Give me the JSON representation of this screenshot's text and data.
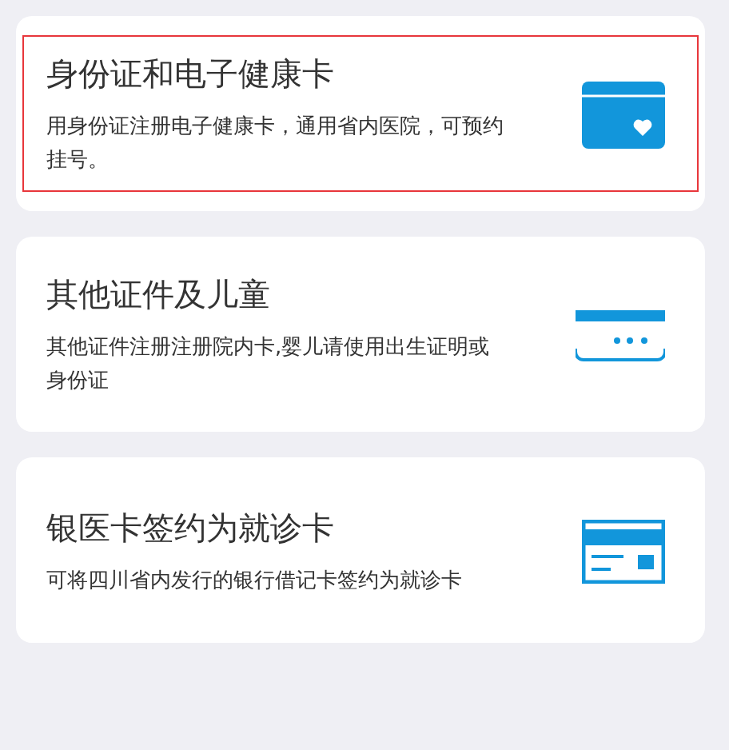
{
  "options": [
    {
      "title": "身份证和电子健康卡",
      "description": "用身份证注册电子健康卡，通用省内医院，可预约挂号。",
      "selected": true
    },
    {
      "title": "其他证件及儿童",
      "description": "其他证件注册注册院内卡,婴儿请使用出生证明或身份证",
      "selected": false
    },
    {
      "title": "银医卡签约为就诊卡",
      "description": "可将四川省内发行的银行借记卡签约为就诊卡",
      "selected": false
    }
  ]
}
